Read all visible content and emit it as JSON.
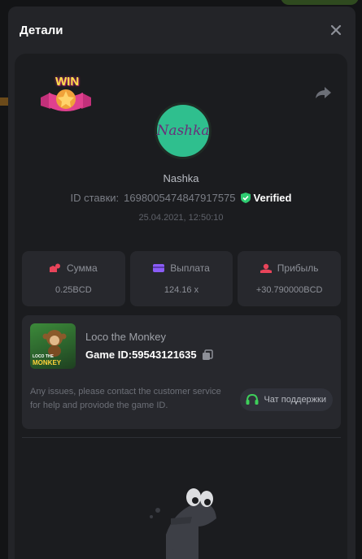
{
  "modal": {
    "title": "Детали"
  },
  "badge": {
    "text": "WIN"
  },
  "user": {
    "avatar_text": "Nashka",
    "name": "Nashka",
    "bet_label": "ID ставки:",
    "bet_id": "1698005474847917575",
    "verified_label": "Verified",
    "date": "25.04.2021, 12:50:10"
  },
  "stats": [
    {
      "label": "Сумма",
      "value": "0.25BCD",
      "icon": "coin-icon",
      "color": "#e8445a"
    },
    {
      "label": "Выплата",
      "value": "124.16 x",
      "icon": "card-icon",
      "color": "#8a5cf6"
    },
    {
      "label": "Прибыль",
      "value": "+30.790000BCD",
      "icon": "profit-icon",
      "color": "#e8445a"
    }
  ],
  "game": {
    "name": "Loco the Monkey",
    "id_label": "Game ID:",
    "id_value": "59543121635",
    "thumb_text_1": "LOCO THE",
    "thumb_text_2": "MONKEY",
    "issue_text": "Any issues, please contact the customer service for help and proviode the game ID.",
    "support_label": "Чат поддержки"
  },
  "colors": {
    "verified": "#2ecc71",
    "accent_red": "#e8445a",
    "accent_purple": "#8a5cf6",
    "support_green": "#3ecf5a"
  }
}
